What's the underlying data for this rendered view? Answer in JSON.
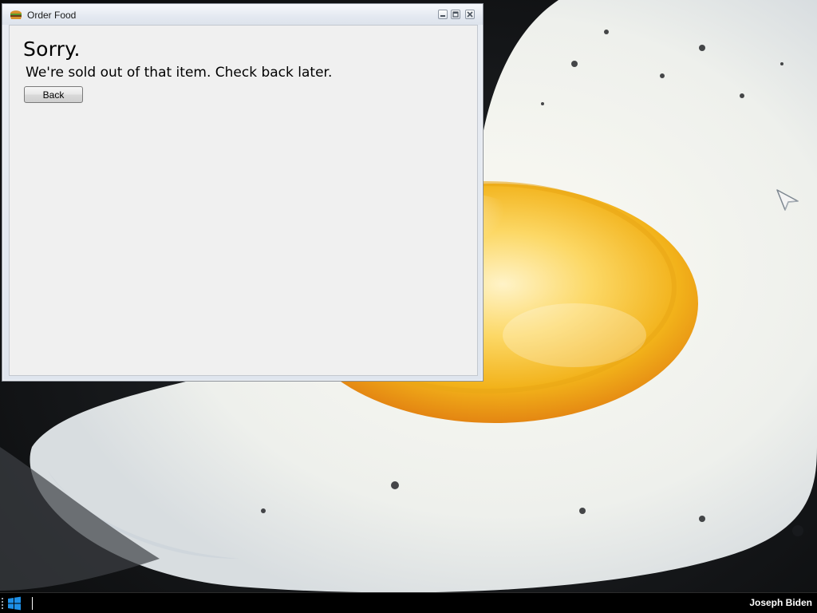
{
  "window": {
    "title": "Order Food",
    "icon": "burger-icon"
  },
  "dialog": {
    "heading": "Sorry.",
    "message": "We're sold out of that item. Check back later.",
    "back_label": "Back"
  },
  "taskbar": {
    "start_icon": "windows-logo-icon",
    "user_name": "Joseph Biden"
  },
  "colors": {
    "client_background": "#f0f0f0",
    "taskbar_background": "#000000",
    "yolk": "#f2b21a"
  }
}
